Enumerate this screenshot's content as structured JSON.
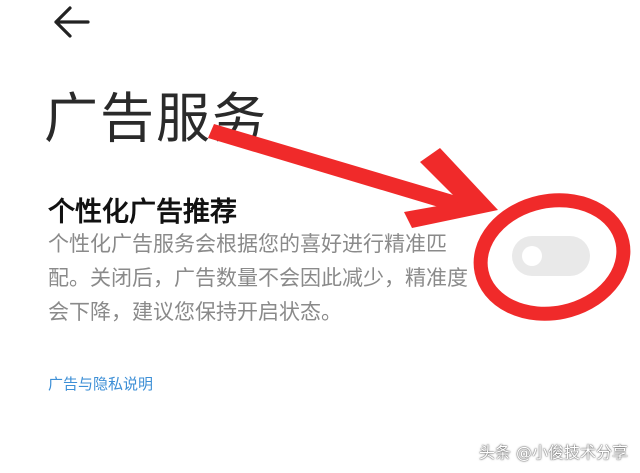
{
  "header": {
    "back_icon": "arrow-left-icon"
  },
  "page": {
    "title": "广告服务"
  },
  "setting": {
    "title": "个性化广告推荐",
    "description": "个性化广告服务会根据您的喜好进行精准匹配。关闭后，广告数量不会因此减少，精准度会下降，建议您保持开启状态。",
    "toggle_enabled": false
  },
  "links": {
    "privacy": "广告与隐私说明"
  },
  "annotation": {
    "color": "#f02a2a",
    "shapes": [
      "arrow",
      "circle"
    ]
  },
  "watermark": {
    "text": "头条 @小俊技术分享"
  },
  "colors": {
    "link": "#3d8fd6",
    "description": "#8a8a8a",
    "toggle_off": "#e9e9e9"
  }
}
